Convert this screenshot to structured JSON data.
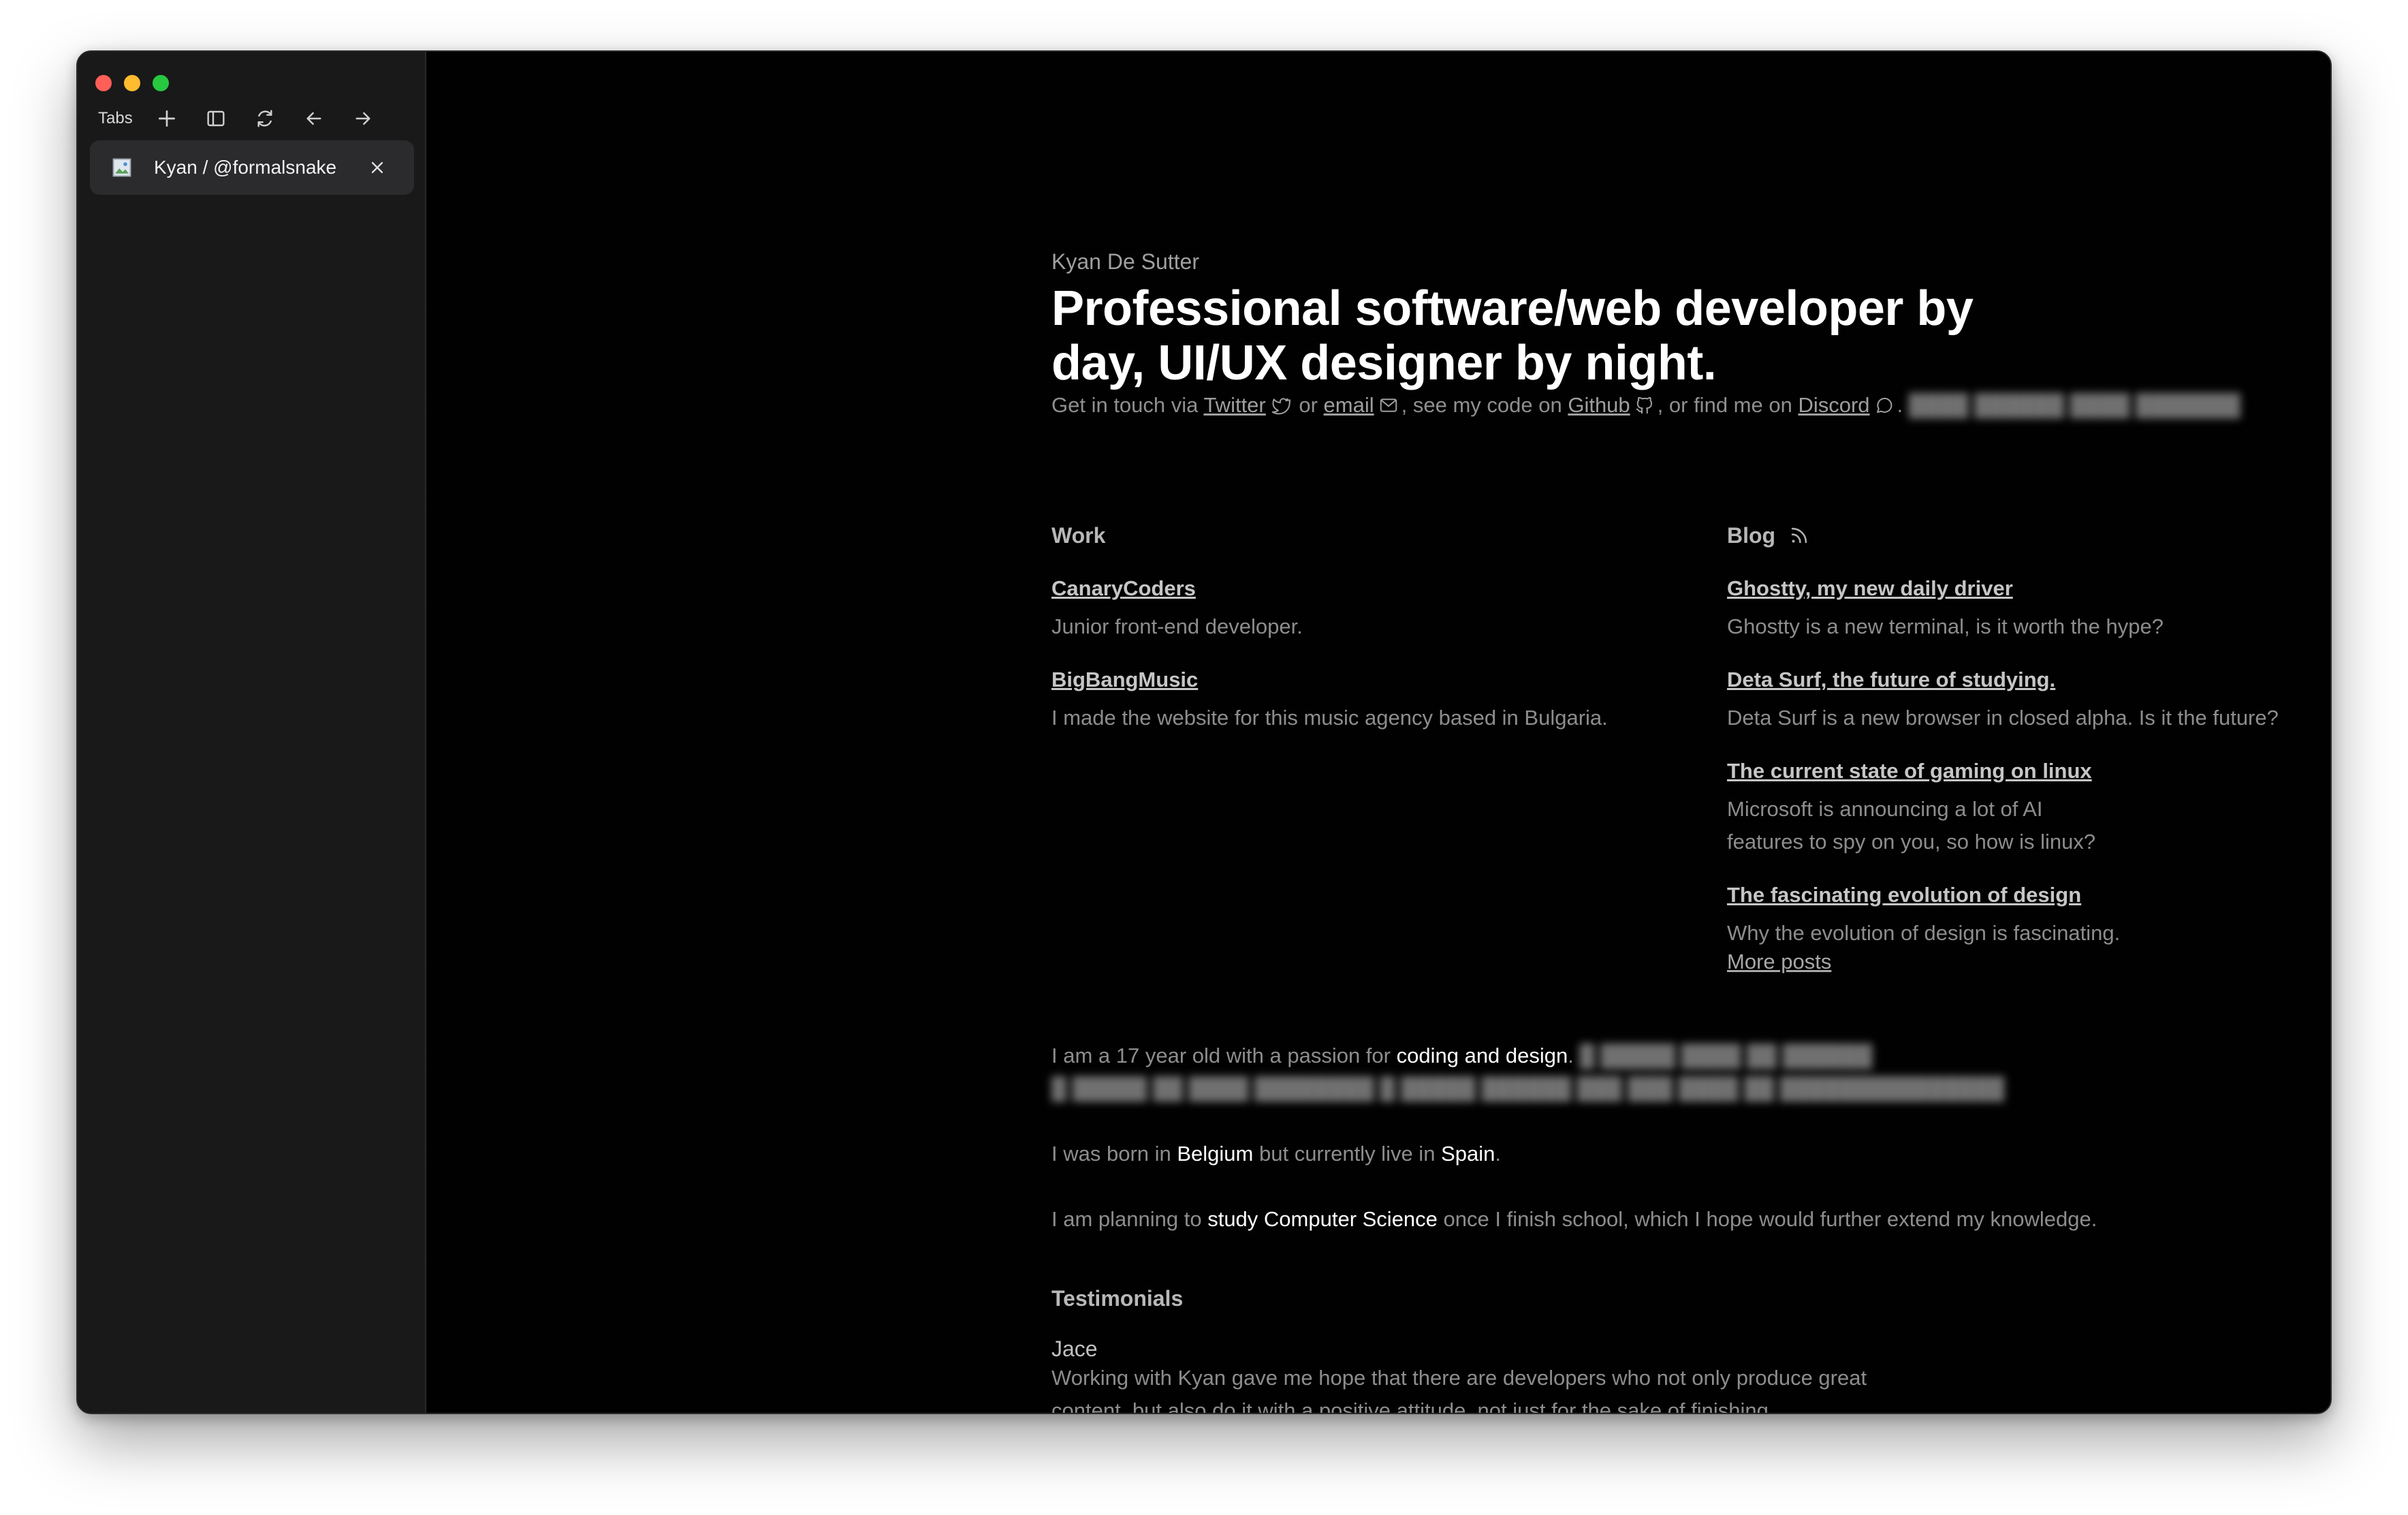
{
  "browser": {
    "tabs_label": "Tabs",
    "active_tab": {
      "title": "Kyan / @formalsnake"
    }
  },
  "hero": {
    "name": "Kyan De Sutter",
    "title": "Professional software/web developer by day, UI/UX designer by night.",
    "contact": {
      "prefix": "Get in touch via ",
      "twitter": "Twitter",
      "or": " or ",
      "email": "email",
      "code_text": ", see my code on ",
      "github": "Github",
      "find_text": ", or find me on ",
      "discord": "Discord",
      "end": "."
    }
  },
  "work": {
    "heading": "Work",
    "items": [
      {
        "title": "CanaryCoders",
        "desc": "Junior front-end developer."
      },
      {
        "title": "BigBangMusic",
        "desc": "I made the website for this music agency based in Bulgaria."
      }
    ]
  },
  "blog": {
    "heading": "Blog",
    "items": [
      {
        "title": "Ghostty, my new daily driver",
        "desc": "Ghostty is a new terminal, is it worth the hype?"
      },
      {
        "title": "Deta Surf, the future of studying.",
        "desc": "Deta Surf is a new browser in closed alpha. Is it the future?"
      },
      {
        "title": "The current state of gaming on linux",
        "desc": "Microsoft is announcing a lot of AI features to spy on you, so how is linux?"
      },
      {
        "title": "The fascinating evolution of design",
        "desc": "Why the evolution of design is fascinating."
      }
    ],
    "more": "More posts"
  },
  "about": {
    "p1_a": "I am a 17 year old with a passion for ",
    "p1_hl": "coding and design",
    "p1_b": ".",
    "p2_a": "I was born in ",
    "p2_hl1": "Belgium",
    "p2_b": " but currently live in ",
    "p2_hl2": "Spain",
    "p2_c": ".",
    "p3_a": "I am planning to ",
    "p3_hl": "study Computer Science",
    "p3_b": " once I finish school, which I hope would further extend my knowledge."
  },
  "testimonials": {
    "heading": "Testimonials",
    "items": [
      {
        "name": "Jace",
        "quote": "Working with Kyan gave me hope that there are developers who not only produce great content, but also do it with a positive attitude, not just for the sake of finishing."
      }
    ]
  },
  "icons": {
    "traffic": [
      "close-dot",
      "minimize-dot",
      "zoom-dot"
    ],
    "toolbar": [
      "new-tab-icon",
      "sidebar-toggle-icon",
      "reload-icon",
      "back-icon",
      "forward-icon"
    ]
  }
}
